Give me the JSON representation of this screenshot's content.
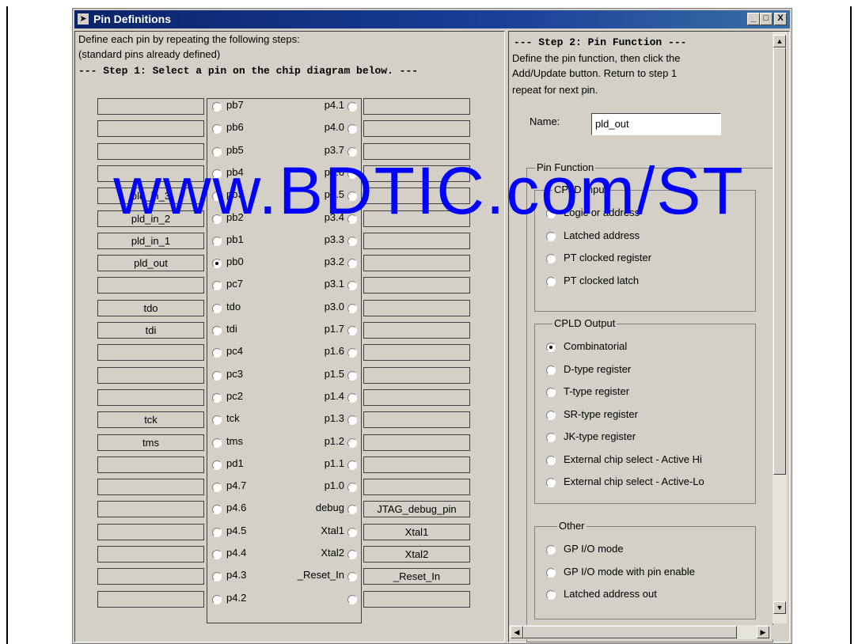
{
  "window": {
    "title": "Pin Definitions",
    "minimize": "_",
    "maximize": "□",
    "close": "X"
  },
  "left": {
    "intro_line1": "Define each pin by repeating the following steps:",
    "intro_line2": "(standard pins already defined)",
    "step1": "--- Step 1: Select a pin on the chip diagram below. ---",
    "left_boxes": [
      "",
      "",
      "",
      "",
      "pld_in_3",
      "pld_in_2",
      "pld_in_1",
      "pld_out",
      "",
      "tdo",
      "tdi",
      "",
      "",
      "",
      "tck",
      "tms",
      "",
      "",
      "",
      "",
      "",
      "",
      ""
    ],
    "left_pins": [
      "pb7",
      "pb6",
      "pb5",
      "pb4",
      "pb3",
      "pb2",
      "pb1",
      "pb0",
      "pc7",
      "tdo",
      "tdi",
      "pc4",
      "pc3",
      "pc2",
      "tck",
      "tms",
      "pd1",
      "p4.7",
      "p4.6",
      "p4.5",
      "p4.4",
      "p4.3",
      "p4.2"
    ],
    "right_pins": [
      "p4.1",
      "p4.0",
      "p3.7",
      "p3.6",
      "p3.5",
      "p3.4",
      "p3.3",
      "p3.2",
      "p3.1",
      "p3.0",
      "p1.7",
      "p1.6",
      "p1.5",
      "p1.4",
      "p1.3",
      "p1.2",
      "p1.1",
      "p1.0",
      "debug",
      "Xtal1",
      "Xtal2",
      "_Reset_In",
      ""
    ],
    "right_boxes": [
      "",
      "",
      "",
      "",
      "",
      "",
      "",
      "",
      "",
      "",
      "",
      "",
      "",
      "",
      "",
      "",
      "",
      "",
      "JTAG_debug_pin",
      "Xtal1",
      "Xtal2",
      "_Reset_In",
      ""
    ],
    "selected_left_index": 7
  },
  "right": {
    "step2": "--- Step 2: Pin Function ---",
    "instr1": "Define the pin function, then click the",
    "instr2": "Add/Update button.  Return to step 1",
    "instr3": "repeat for next pin.",
    "name_label": "Name:",
    "name_value": "pld_out",
    "pin_function_label": "Pin Function",
    "cpld_input_label": "CPLD Input",
    "cpld_input_options": [
      "Logic or address",
      "Latched address",
      "PT clocked register",
      "PT clocked latch"
    ],
    "cpld_output_label": "CPLD Output",
    "cpld_output_options": [
      "Combinatorial",
      "D-type register",
      "T-type register",
      "SR-type register",
      "JK-type register",
      "External chip select - Active Hi",
      "External chip select - Active-Lo"
    ],
    "cpld_output_selected": 0,
    "other_label": "Other",
    "other_options": [
      "GP I/O mode",
      "GP I/O mode with pin enable",
      "Latched address out"
    ]
  },
  "watermark": "www.BDTIC.com/ST",
  "colors": {
    "titlebar": "#0a246a",
    "face": "#d4d0c8",
    "watermark": "#0000ff"
  }
}
